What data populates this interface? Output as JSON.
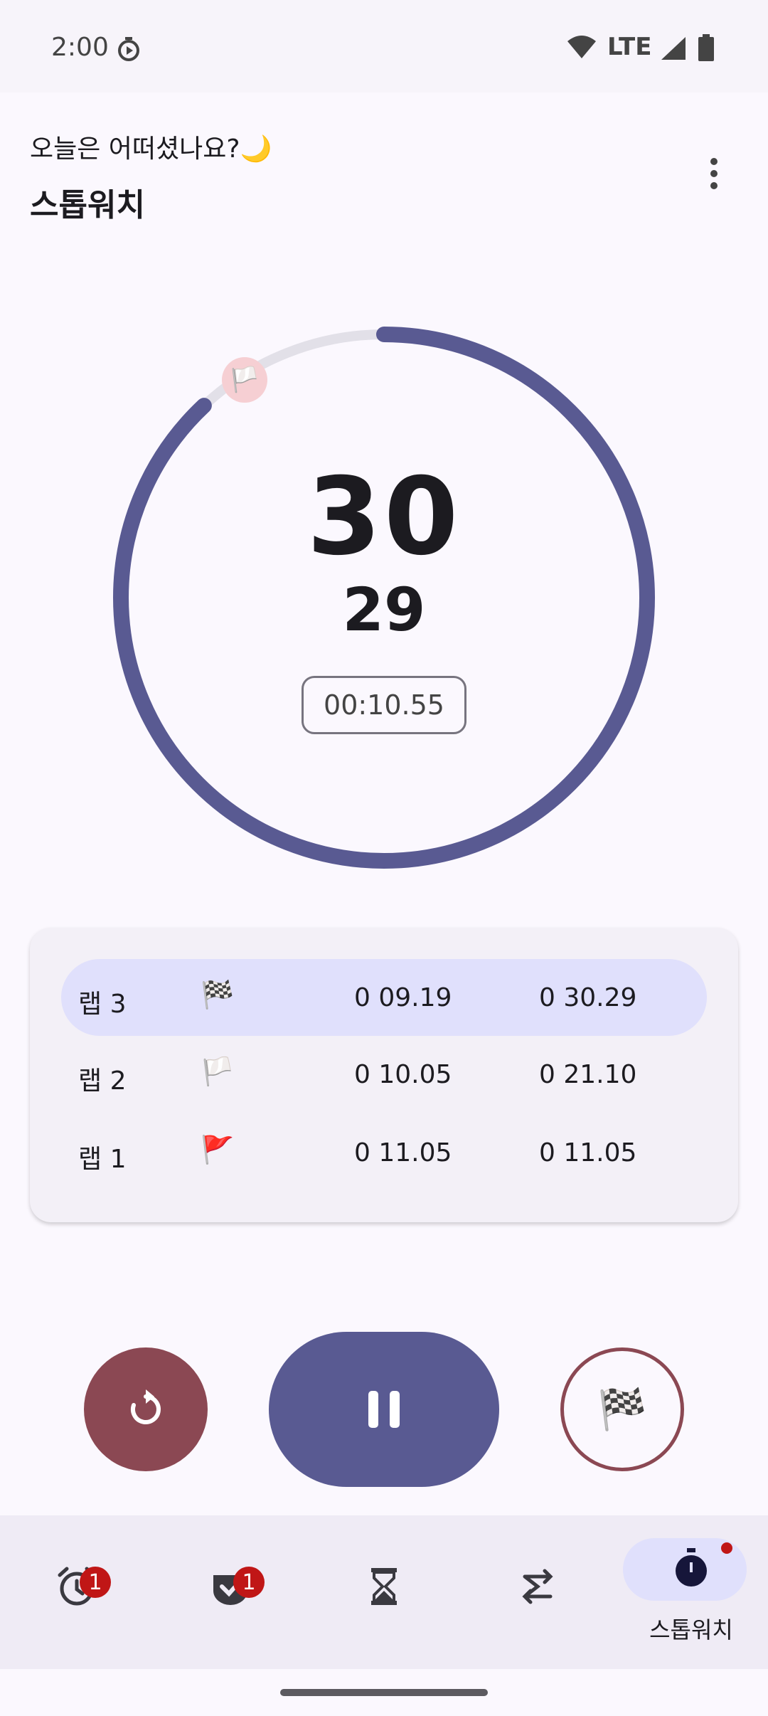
{
  "status_bar": {
    "time": "2:00",
    "network": "LTE"
  },
  "header": {
    "greeting": "오늘은 어떠셨나요?🌙",
    "title": "스톱워치"
  },
  "stopwatch": {
    "seconds": "30",
    "centiseconds": "29",
    "current_lap_time": "00:10.55",
    "lap_marker_icon": "🏳️",
    "progress_fraction": 0.88
  },
  "laps": [
    {
      "label": "랩 3",
      "flag": "🏁",
      "split": "0 09.19",
      "total": "0 30.29",
      "active": true
    },
    {
      "label": "랩 2",
      "flag": "🏳️",
      "split": "0 10.05",
      "total": "0 21.10",
      "active": false
    },
    {
      "label": "랩 1",
      "flag": "🚩",
      "split": "0 11.05",
      "total": "0 11.05",
      "active": false
    }
  ],
  "controls": {
    "lap_icon": "🏁"
  },
  "nav": {
    "items": [
      {
        "name": "alarm",
        "icon": "alarm-icon",
        "badge": "1",
        "label": ""
      },
      {
        "name": "tasks",
        "icon": "check-icon",
        "badge": "1",
        "label": ""
      },
      {
        "name": "timer",
        "icon": "hourglass-icon",
        "badge": "",
        "label": ""
      },
      {
        "name": "repeat",
        "icon": "repeat-icon",
        "badge": "",
        "label": ""
      },
      {
        "name": "stopwatch",
        "icon": "stopwatch-icon",
        "badge": "",
        "label": "스톱워치",
        "selected": true
      }
    ]
  },
  "colors": {
    "accent": "#595a92",
    "reset": "#8b4853",
    "track": "#e2e0e8",
    "active_row": "#e0e0fc",
    "badge": "#c01616"
  }
}
